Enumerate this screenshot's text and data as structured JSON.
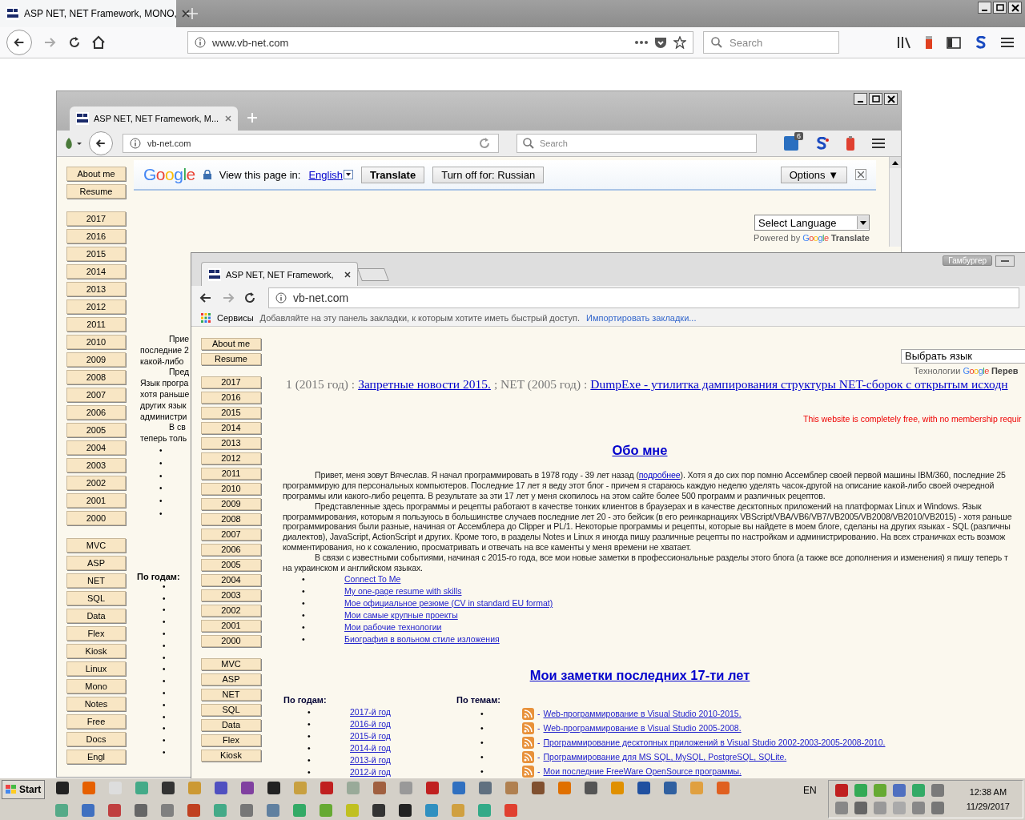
{
  "browser": {
    "tab_title": "ASP NET, NET Framework, MONO,",
    "url": "www.vb-net.com",
    "search_placeholder": "Search"
  },
  "middle_window": {
    "tab_title": "ASP NET, NET Framework, M...",
    "url": "vb-net.com",
    "search_placeholder": "Search",
    "badge": "6",
    "translate_bar": {
      "logo": "Google",
      "prompt": "View this page in:",
      "language": "English",
      "translate_button": "Translate",
      "turn_off_button": "Turn off for: Russian",
      "options_button": "Options ▼"
    },
    "sidebar": {
      "top": [
        "About me",
        "Resume"
      ],
      "years": [
        "2017",
        "2016",
        "2015",
        "2014",
        "2013",
        "2012",
        "2011",
        "2010",
        "2009",
        "2008",
        "2007",
        "2006",
        "2005",
        "2004",
        "2003",
        "2002",
        "2001",
        "2000"
      ],
      "topics": [
        "MVC",
        "ASP",
        "NET",
        "SQL",
        "Data",
        "Flex",
        "Kiosk",
        "Linux",
        "Mono",
        "Notes",
        "Free",
        "Docs",
        "Engl"
      ]
    },
    "language_select": "Select Language",
    "powered_by": "Powered by",
    "powered_logo": "Google",
    "powered_label": "Translate",
    "text_lines": [
      {
        "text": "Прие",
        "indent": true
      },
      {
        "text": "последние 2",
        "indent": false
      },
      {
        "text": "какой-либо",
        "indent": false
      },
      {
        "text": "Пред",
        "indent": true
      },
      {
        "text": "Язык програ",
        "indent": false
      },
      {
        "text": "хотя раньше",
        "indent": false
      },
      {
        "text": "других язык",
        "indent": false
      },
      {
        "text": "администри",
        "indent": false
      },
      {
        "text": "В св",
        "indent": true
      },
      {
        "text": "теперь толь",
        "indent": false
      }
    ],
    "link_bullets": [
      "•",
      "•",
      "•",
      "•",
      "•",
      "•"
    ],
    "years_heading": "По годам:",
    "year_bullets": [
      "•",
      "•",
      "•",
      "•",
      "•",
      "•",
      "•",
      "•",
      "•",
      "•",
      "•",
      "•",
      "•",
      "•",
      "•"
    ]
  },
  "inner_window": {
    "tab_title": "ASP NET, NET Framework,",
    "user_button": "Гамбургер",
    "url": "vb-net.com",
    "bookmarks": {
      "apps": "Сервисы",
      "hint": "Добавляйте на эту панель закладки, к которым хотите иметь быстрый доступ.",
      "import_link": "Импортировать закладки..."
    },
    "sidebar": {
      "top": [
        "About me",
        "Resume"
      ],
      "years": [
        "2017",
        "2016",
        "2015",
        "2014",
        "2013",
        "2012",
        "2011",
        "2010",
        "2009",
        "2008",
        "2007",
        "2006",
        "2005",
        "2004",
        "2003",
        "2002",
        "2001",
        "2000"
      ],
      "topics": [
        "MVC",
        "ASP",
        "NET",
        "SQL",
        "Data",
        "Flex",
        "Kiosk"
      ]
    },
    "language_select": "Выбрать язык",
    "powered_by": "Технологии",
    "powered_logo": "Google",
    "powered_label": "Перев",
    "news": [
      {
        "kind": "text",
        "text": "1 (2015 год) :"
      },
      {
        "kind": "link",
        "text": "Запретные новости 2015."
      },
      {
        "kind": "text",
        "text": "; NET (2005 год) :"
      },
      {
        "kind": "link",
        "text": "DumpExe - утилитка дампирования структуры NET-сборок с открытым исходн"
      }
    ],
    "notice": "This website is completely free, with no membership requir",
    "about_heading": "Обо мне",
    "paragraph_lines": [
      {
        "indent": true,
        "text": "Привет, меня зовут Вячеслав. Я начал программировать в 1978 году - 39 лет назад (",
        "link": "подробнее",
        "rest": "). Хотя я до сих пор помню Ассемблер своей первой машины IBM/360, последние 25"
      },
      {
        "indent": false,
        "text": "программирую для персональных компьютеров. Последние 17 лет я веду этот блог - причем я стараюсь каждую неделю уделять часок-другой на описание какой-либо своей очередной"
      },
      {
        "indent": false,
        "text": "программы или какого-либо рецепта. В результате за эти 17 лет у меня скопилось на этом сайте более 500 программ и различных рецептов."
      },
      {
        "indent": true,
        "text": "Представленные здесь программы и рецепты работают в качестве тонких клиентов в браузерах и в качестве десктопных приложений на платформах Linux и Windows. Язык"
      },
      {
        "indent": false,
        "text": "программирования, которым я пользуюсь в большинстве случаев последние лет 20 - это бейсик (в его реинкарнациях VBScript/VBA/VB6/VB7/VB2005/VB2008/VB2010/VB2015) - хотя раньше"
      },
      {
        "indent": false,
        "text": "программирования были разные, начиная от Ассемблера до Clipper и PL/1. Некоторые программы и рецепты, которые вы найдете в моем блоге, сделаны на других языках - SQL (различны"
      },
      {
        "indent": false,
        "text": "диалектов), JavaScript, ActionScript и других. Кроме того, в разделы Notes и Linux я иногда пишу различные рецепты по настройкам и администрированию. На всех страничках есть возмож"
      },
      {
        "indent": false,
        "text": "комментирования, но к сожалению, просматривать и отвечать на все каменты у меня времени не хватает."
      },
      {
        "indent": true,
        "text": "В связи с известными событиями, начиная с 2015-го года, все мои новые заметки в профессиональные разделы этого блога (а также все дополнения и изменения) я пишу теперь т"
      },
      {
        "indent": false,
        "text": "на украинском и английском языках."
      }
    ],
    "about_links": [
      {
        "bullet": "•",
        "text": "Connect To Me"
      },
      {
        "bullet": "•",
        "text": "My one-page resume with skills"
      },
      {
        "bullet": "•",
        "text": "Мое официальное резюме (CV in standard EU format)"
      },
      {
        "bullet": "•",
        "text": "Мои самые крупные проекты"
      },
      {
        "bullet": "•",
        "text": "Мои рабочие технологии"
      },
      {
        "bullet": "•",
        "text": "Биография в вольном стиле изложения"
      }
    ],
    "notes_heading": "Мои заметки последних 17-ти лет",
    "by_year": {
      "heading": "По годам:",
      "items": [
        {
          "bullet": "•",
          "text": "2017-й год"
        },
        {
          "bullet": "•",
          "text": "2016-й год"
        },
        {
          "bullet": "•",
          "text": "2015-й год"
        },
        {
          "bullet": "•",
          "text": "2014-й год"
        },
        {
          "bullet": "•",
          "text": "2013-й год"
        },
        {
          "bullet": "•",
          "text": "2012-й год"
        }
      ]
    },
    "by_topic": {
      "heading": "По темам:",
      "items": [
        {
          "bullet": "•",
          "dash": "-",
          "text": "Web-программирование в Visual Studio 2010-2015."
        },
        {
          "bullet": "•",
          "dash": "-",
          "text": "Web-программирование в Visual Studio 2005-2008."
        },
        {
          "bullet": "•",
          "dash": "-",
          "text": "Программирование десктопных приложений в Visual Studio 2002-2003-2005-2008-2010."
        },
        {
          "bullet": "•",
          "dash": "-",
          "text": "Программирование для MS SQL, MySQL, PostgreSQL, SQLite."
        },
        {
          "bullet": "•",
          "dash": "-",
          "text": "Мои последние FreeWare OpenSource программы."
        }
      ]
    }
  },
  "taskbar": {
    "start": "Start",
    "language": "EN",
    "time": "12:38 AM",
    "date": "11/29/2017"
  }
}
